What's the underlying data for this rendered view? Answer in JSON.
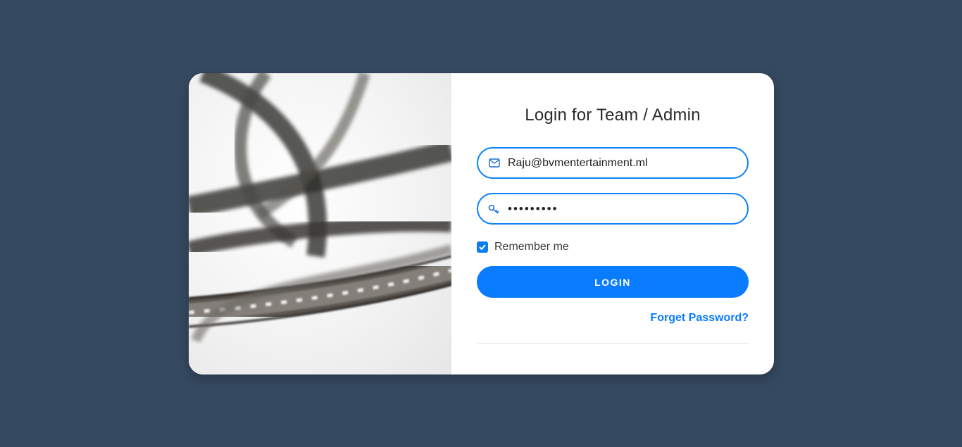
{
  "title": "Login for Team / Admin",
  "email_field": {
    "value": "Raju@bvmentertainment.ml",
    "icon": "envelope-icon"
  },
  "password_field": {
    "value": "•••••••••",
    "icon": "key-icon"
  },
  "remember": {
    "label": "Remember me",
    "checked": true
  },
  "login_button": {
    "label": "LOGIN"
  },
  "forgot_link": {
    "label": "Forget Password?"
  },
  "colors": {
    "background": "#354960",
    "accent": "#0a7cff",
    "card": "#ffffff"
  }
}
